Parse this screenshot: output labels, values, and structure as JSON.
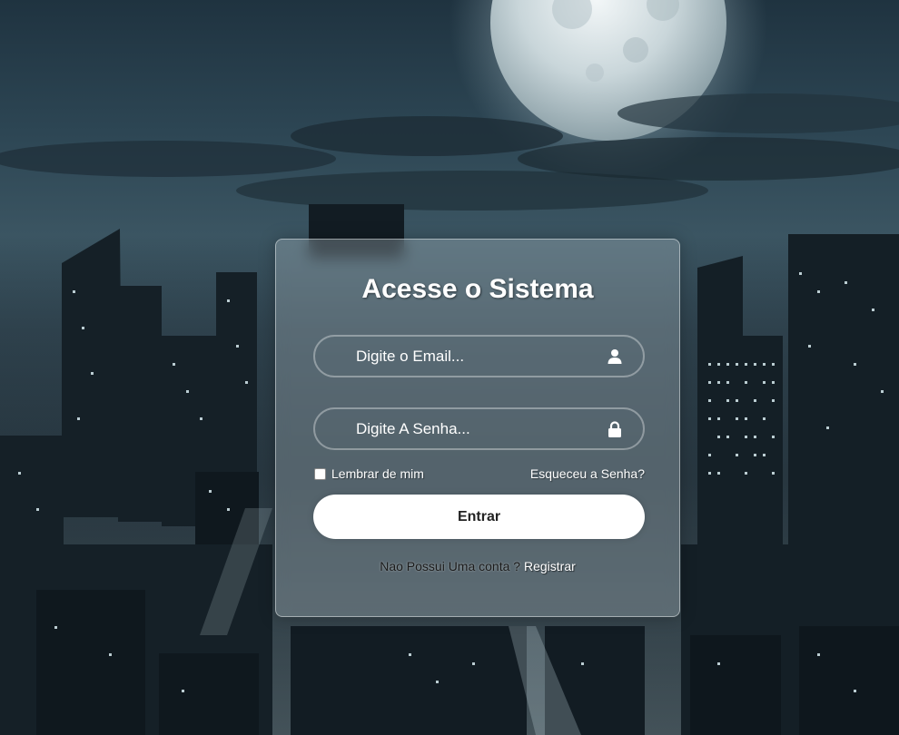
{
  "login": {
    "title": "Acesse o Sistema",
    "email_placeholder": "Digite o Email...",
    "password_placeholder": "Digite A Senha...",
    "remember_label": "Lembrar de mim",
    "forgot_link": "Esqueceu a Senha?",
    "submit_label": "Entrar",
    "no_account_text": "Nao Possui Uma conta ?",
    "register_link": "Registrar"
  },
  "icons": {
    "email": "user-icon",
    "password": "lock-icon"
  },
  "colors": {
    "button_bg": "#ffffff",
    "button_text": "#222222",
    "text": "#ffffff"
  }
}
